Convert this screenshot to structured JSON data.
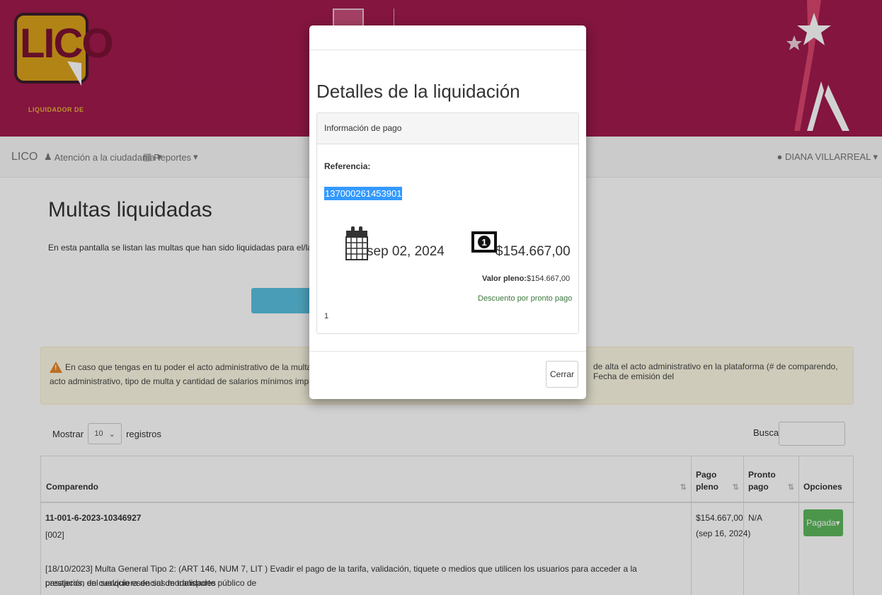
{
  "colors": {
    "banner": "#a01a4e",
    "accent_blue": "#3399ff",
    "success": "#5cb85c",
    "info": "#5bc0de",
    "warning_bg": "#fcf8e3"
  },
  "header": {
    "logo_text": "LICO",
    "logo_subtitle": "LIQUIDADOR DE"
  },
  "navbar": {
    "brand": "LICO",
    "items": [
      {
        "icon": "users-icon",
        "label": "Atención a la ciudadanía"
      },
      {
        "icon": "bar-chart-icon",
        "label": "Reportes"
      }
    ],
    "user": "DIANA VILLARREAL"
  },
  "page": {
    "title": "Multas liquidadas",
    "description": "En esta pantalla se listan las multas que han sido liquidadas para el/la ciudadano/a identi",
    "alert_line1": "En caso que tengas en tu poder el acto administrativo de la multa sobre la cual dese",
    "alert_line1b": "de alta el acto administrativo en la plataforma (# de comparendo, Fecha de emisión del",
    "alert_line2": "acto administrativo, tipo de multa y cantidad de salarios mínimos impuestos)."
  },
  "table_controls": {
    "show_label": "Mostrar",
    "page_size": "10",
    "records_label": "registros",
    "search_label": "Buscar:"
  },
  "table": {
    "headers": {
      "comparendo": "Comparendo",
      "pago_pleno_1": "Pago",
      "pago_pleno_2": "pleno",
      "pronto_pago_1": "Pronto",
      "pronto_pago_2": "pago",
      "opciones": "Opciones"
    },
    "row": {
      "comparendo_id": "11-001-6-2023-10346927",
      "code": "[002]",
      "description_1": "[18/10/2023] Multa General Tipo 2: (ART 146, NUM 7, LIT ) Evadir el pago de la tarifa, validación, tiquete o medios que utilicen los usuarios para acceder a la prestación del servicio esencial de transporte público de",
      "description_2": "pasajeros, en cualquiera de sus modalidades",
      "pago_pleno": "$154.667,00",
      "pago_pleno_date": "(sep 16, 2024)",
      "pronto_pago": "N/A",
      "status_button": "Pagada"
    }
  },
  "modal": {
    "title": "Detalles de la liquidación",
    "panel_title": "Información de pago",
    "reference_label": "Referencia:",
    "reference_value": "137000261453901",
    "date": "sep 02, 2024",
    "amount": "$154.667,00",
    "valor_pleno_label": "Valor pleno:",
    "valor_pleno_value": "$154.667,00",
    "discount_text": "Descuento por pronto pago",
    "footer_number": "1",
    "close_button": "Cerrar"
  }
}
